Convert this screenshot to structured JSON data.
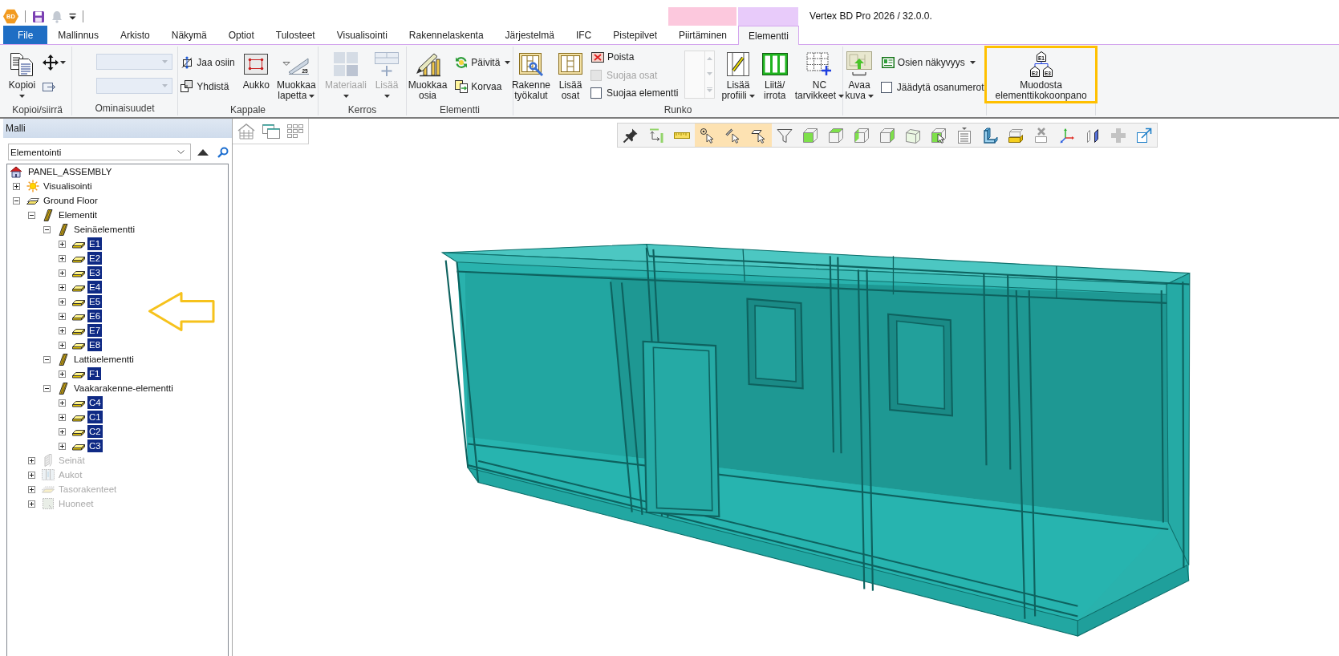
{
  "app": {
    "logo": "BD",
    "title": "Vertex BD Pro 2026 / 32.0.0."
  },
  "tabs": [
    {
      "label": "File",
      "kind": "file",
      "selected": false
    },
    {
      "label": "Mallinnus",
      "kind": "standard",
      "selected": false
    },
    {
      "label": "Arkisto",
      "kind": "standard",
      "selected": false
    },
    {
      "label": "Näkymä",
      "kind": "standard",
      "selected": false
    },
    {
      "label": "Optiot",
      "kind": "standard",
      "selected": false
    },
    {
      "label": "Tulosteet",
      "kind": "standard",
      "selected": false
    },
    {
      "label": "Visualisointi",
      "kind": "standard",
      "selected": false
    },
    {
      "label": "Rakennelaskenta",
      "kind": "standard",
      "selected": false
    },
    {
      "label": "Järjestelmä",
      "kind": "standard",
      "selected": false
    },
    {
      "label": "IFC",
      "kind": "standard",
      "selected": false
    },
    {
      "label": "Pistepilvet",
      "kind": "standard",
      "selected": false
    },
    {
      "label": "Piirtäminen",
      "kind": "contextual",
      "color": "#fcc8dd",
      "selected": false
    },
    {
      "label": "Elementti",
      "kind": "contextual",
      "color": "#e8cbfa",
      "selected": true
    }
  ],
  "ribbon": {
    "groups": [
      {
        "label": "Kopioi/siirrä",
        "columns": [
          [
            {
              "kind": "large",
              "label": "Kopioi",
              "dropdown": true,
              "disabled": false
            }
          ],
          [
            {
              "kind": "icon",
              "dropdown": true,
              "disabled": false
            },
            {
              "kind": "icon",
              "disabled": false
            }
          ]
        ]
      },
      {
        "label": "Ominaisuudet",
        "columns": [
          [
            {
              "kind": "combo",
              "disabled": true
            },
            {
              "kind": "combo",
              "disabled": true
            }
          ]
        ]
      },
      {
        "label": "Kappale",
        "columns": [
          [
            {
              "kind": "small",
              "label": "Jaa osiin",
              "disabled": false
            },
            {
              "kind": "small",
              "label": "Yhdistä",
              "disabled": false
            }
          ],
          [
            {
              "kind": "large",
              "label": "Aukko",
              "disabled": false
            }
          ],
          [
            {
              "kind": "large",
              "label": "Muokkaa lapetta",
              "icon_labels": [
                "25"
              ],
              "dropdown": true,
              "disabled": false
            }
          ]
        ]
      },
      {
        "label": "Kerros",
        "columns": [
          [
            {
              "kind": "large",
              "label": "Materiaali",
              "dropdown": true,
              "disabled": true
            }
          ],
          [
            {
              "kind": "large",
              "label": "Lisää",
              "dropdown": true,
              "disabled": true
            }
          ]
        ]
      },
      {
        "label": "Elementti",
        "columns": [
          [
            {
              "kind": "large",
              "label": "Muokkaa osia",
              "disabled": false
            }
          ],
          [
            {
              "kind": "small",
              "label": "Päivitä",
              "dropdown": true,
              "disabled": false
            },
            {
              "kind": "small",
              "label": "Korvaa",
              "disabled": false
            }
          ]
        ]
      },
      {
        "label": "Runko",
        "columns": [
          [
            {
              "kind": "large",
              "label": "Rakenne työkalut",
              "disabled": false
            }
          ],
          [
            {
              "kind": "large",
              "label": "Lisää osat",
              "disabled": false
            }
          ],
          [
            {
              "kind": "small",
              "label": "Poista",
              "disabled": false
            },
            {
              "kind": "checkbox",
              "label": "Suojaa osat",
              "checked": false,
              "disabled": true
            },
            {
              "kind": "checkbox",
              "label": "Suojaa elementti",
              "checked": false,
              "disabled": false
            }
          ],
          [
            {
              "kind": "gallery",
              "disabled": true
            }
          ],
          [
            {
              "kind": "large",
              "label": "Lisää profiili",
              "dropdown": true,
              "disabled": false
            }
          ],
          [
            {
              "kind": "large",
              "label": "Liitä/irrota",
              "disabled": false
            }
          ],
          [
            {
              "kind": "large",
              "label": "NC tarvikkeet",
              "dropdown": true,
              "disabled": false
            }
          ]
        ]
      },
      {
        "columns": [
          [
            {
              "kind": "large",
              "label": "Avaa kuva",
              "dropdown": true,
              "disabled": false
            }
          ],
          [
            {
              "kind": "small",
              "label": "Osien näkyvyys",
              "dropdown": true,
              "disabled": false
            },
            {
              "kind": "checkbox",
              "label": "Jäädytä osanumerot",
              "checked": false,
              "disabled": false
            }
          ]
        ]
      },
      {
        "columns": [
          [
            {
              "kind": "large",
              "label": "Muodosta elementtikokoonpano",
              "icon_labels": [
                "E1",
                "E2",
                "E3"
              ],
              "highlighted": true,
              "disabled": false
            }
          ]
        ]
      }
    ]
  },
  "model_panel": {
    "title": "Malli",
    "view_select": {
      "value": "Elementointi"
    },
    "tree": {
      "label": "PANEL_ASSEMBLY",
      "kind": "model",
      "selected": false,
      "children": [
        {
          "label": "Visualisointi",
          "kind": "visualization",
          "expanded": false,
          "selected": false,
          "disabled": false
        },
        {
          "label": "Ground Floor",
          "kind": "floor",
          "expanded": true,
          "selected": false,
          "disabled": false,
          "children": [
            {
              "label": "Elementit",
              "kind": "category",
              "expanded": true,
              "selected": false,
              "disabled": false,
              "children": [
                {
                  "label": "Seinäelementti",
                  "kind": "category",
                  "expanded": true,
                  "selected": false,
                  "disabled": false,
                  "children": [
                    {
                      "label": "E1",
                      "kind": "element",
                      "expanded": false,
                      "selected": true,
                      "disabled": false
                    },
                    {
                      "label": "E2",
                      "kind": "element",
                      "expanded": false,
                      "selected": true,
                      "disabled": false
                    },
                    {
                      "label": "E3",
                      "kind": "element",
                      "expanded": false,
                      "selected": true,
                      "disabled": false
                    },
                    {
                      "label": "E4",
                      "kind": "element",
                      "expanded": false,
                      "selected": true,
                      "disabled": false
                    },
                    {
                      "label": "E5",
                      "kind": "element",
                      "expanded": false,
                      "selected": true,
                      "disabled": false
                    },
                    {
                      "label": "E6",
                      "kind": "element",
                      "expanded": false,
                      "selected": true,
                      "disabled": false
                    },
                    {
                      "label": "E7",
                      "kind": "element",
                      "expanded": false,
                      "selected": true,
                      "disabled": false
                    },
                    {
                      "label": "E8",
                      "kind": "element",
                      "expanded": false,
                      "selected": true,
                      "disabled": false
                    }
                  ]
                },
                {
                  "label": "Lattiaelementti",
                  "kind": "category",
                  "expanded": true,
                  "selected": false,
                  "disabled": false,
                  "children": [
                    {
                      "label": "F1",
                      "kind": "element",
                      "expanded": false,
                      "selected": true,
                      "disabled": false
                    }
                  ]
                },
                {
                  "label": "Vaakarakenne-elementti",
                  "kind": "category",
                  "expanded": true,
                  "selected": false,
                  "disabled": false,
                  "children": [
                    {
                      "label": "C4",
                      "kind": "element",
                      "expanded": false,
                      "selected": true,
                      "disabled": false
                    },
                    {
                      "label": "C1",
                      "kind": "element",
                      "expanded": false,
                      "selected": true,
                      "disabled": false
                    },
                    {
                      "label": "C2",
                      "kind": "element",
                      "expanded": false,
                      "selected": true,
                      "disabled": false
                    },
                    {
                      "label": "C3",
                      "kind": "element",
                      "expanded": false,
                      "selected": true,
                      "disabled": false
                    }
                  ]
                }
              ]
            },
            {
              "label": "Seinät",
              "kind": "walls",
              "expanded": false,
              "selected": false,
              "disabled": true
            },
            {
              "label": "Aukot",
              "kind": "openings",
              "expanded": false,
              "selected": false,
              "disabled": true
            },
            {
              "label": "Tasorakenteet",
              "kind": "slabs",
              "expanded": false,
              "selected": false,
              "disabled": true
            },
            {
              "label": "Huoneet",
              "kind": "rooms",
              "expanded": false,
              "selected": false,
              "disabled": true
            }
          ]
        }
      ]
    }
  },
  "viewport": {
    "toolbar": [
      {
        "selected": false
      },
      {
        "selected": false
      },
      {
        "selected": false
      },
      {
        "selected": true
      },
      {
        "selected": true
      },
      {
        "selected": true
      },
      {
        "selected": false
      },
      {
        "selected": false
      },
      {
        "selected": false
      },
      {
        "selected": false
      },
      {
        "selected": false
      },
      {
        "selected": false
      },
      {
        "selected": false
      },
      {
        "selected": false
      },
      {
        "selected": false
      },
      {
        "selected": false
      },
      {
        "selected": false
      },
      {
        "selected": false
      },
      {
        "selected": false
      },
      {
        "selected": false
      },
      {
        "selected": false
      }
    ]
  }
}
